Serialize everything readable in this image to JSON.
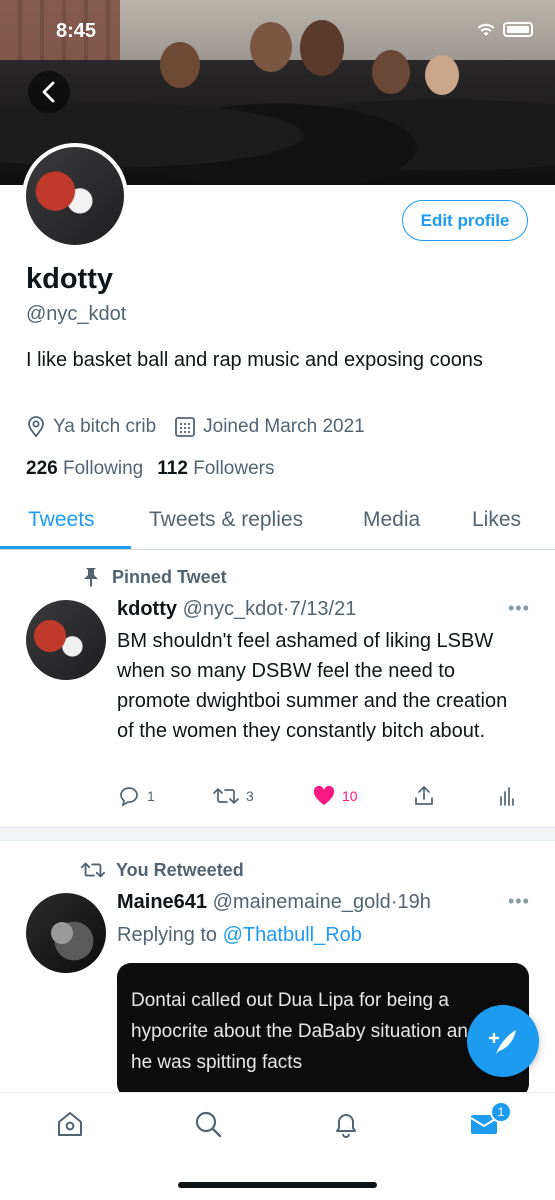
{
  "status_bar": {
    "time": "8:45"
  },
  "profile": {
    "name": "kdotty",
    "handle": "@nyc_kdot",
    "bio": "I like basket ball and rap music and exposing coons",
    "location": "Ya bitch crib",
    "joined": "Joined March 2021",
    "following_count": "226",
    "following_label": "Following",
    "followers_count": "112",
    "followers_label": "Followers",
    "edit_button": "Edit profile"
  },
  "tabs": [
    {
      "label": "Tweets",
      "active": true
    },
    {
      "label": "Tweets & replies",
      "active": false
    },
    {
      "label": "Media",
      "active": false
    },
    {
      "label": "Likes",
      "active": false
    }
  ],
  "tweets": [
    {
      "context": "Pinned Tweet",
      "context_icon": "pin-icon",
      "name": "kdotty",
      "handle": "@nyc_kdot",
      "sep": "·",
      "date": "7/13/21",
      "text": "BM shouldn't feel ashamed of liking LSBW when so many DSBW feel the need to promote dwightboi summer and the creation of the women they constantly bitch about.",
      "replies": "1",
      "retweets": "3",
      "likes": "10",
      "liked": true
    },
    {
      "context": "You Retweeted",
      "context_icon": "retweet-icon",
      "name": "Maine641",
      "handle": "@mainemaine_gold",
      "sep": "·",
      "date": "19h",
      "replying_prefix": "Replying to",
      "replying_to": "@Thatbull_Rob",
      "media_text": "Dontai called out Dua Lipa for being a hypocrite about the DaBaby situation and he was spitting facts"
    }
  ],
  "bottom_nav": {
    "items": [
      "home-icon",
      "search-icon",
      "notifications-icon",
      "messages-icon"
    ],
    "messages_badge": "1"
  },
  "colors": {
    "accent": "#1d9bf0",
    "like": "#f91880",
    "text_primary": "#0f1419",
    "text_secondary": "#536471"
  }
}
